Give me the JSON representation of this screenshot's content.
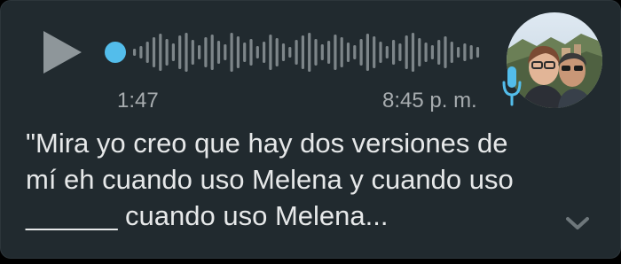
{
  "voice_message": {
    "duration": "1:47",
    "sent_time": "8:45 p. m.",
    "playback_progress": 0,
    "play_icon": "play-icon",
    "mic_icon": "microphone-icon",
    "accent_color": "#53bdeb"
  },
  "transcript": {
    "text": "\"Mira yo creo que hay dos versiones de\nmí eh cuando uso Melena y cuando uso\n______ cuando uso Melena...",
    "expand_icon": "chevron-down-icon"
  }
}
